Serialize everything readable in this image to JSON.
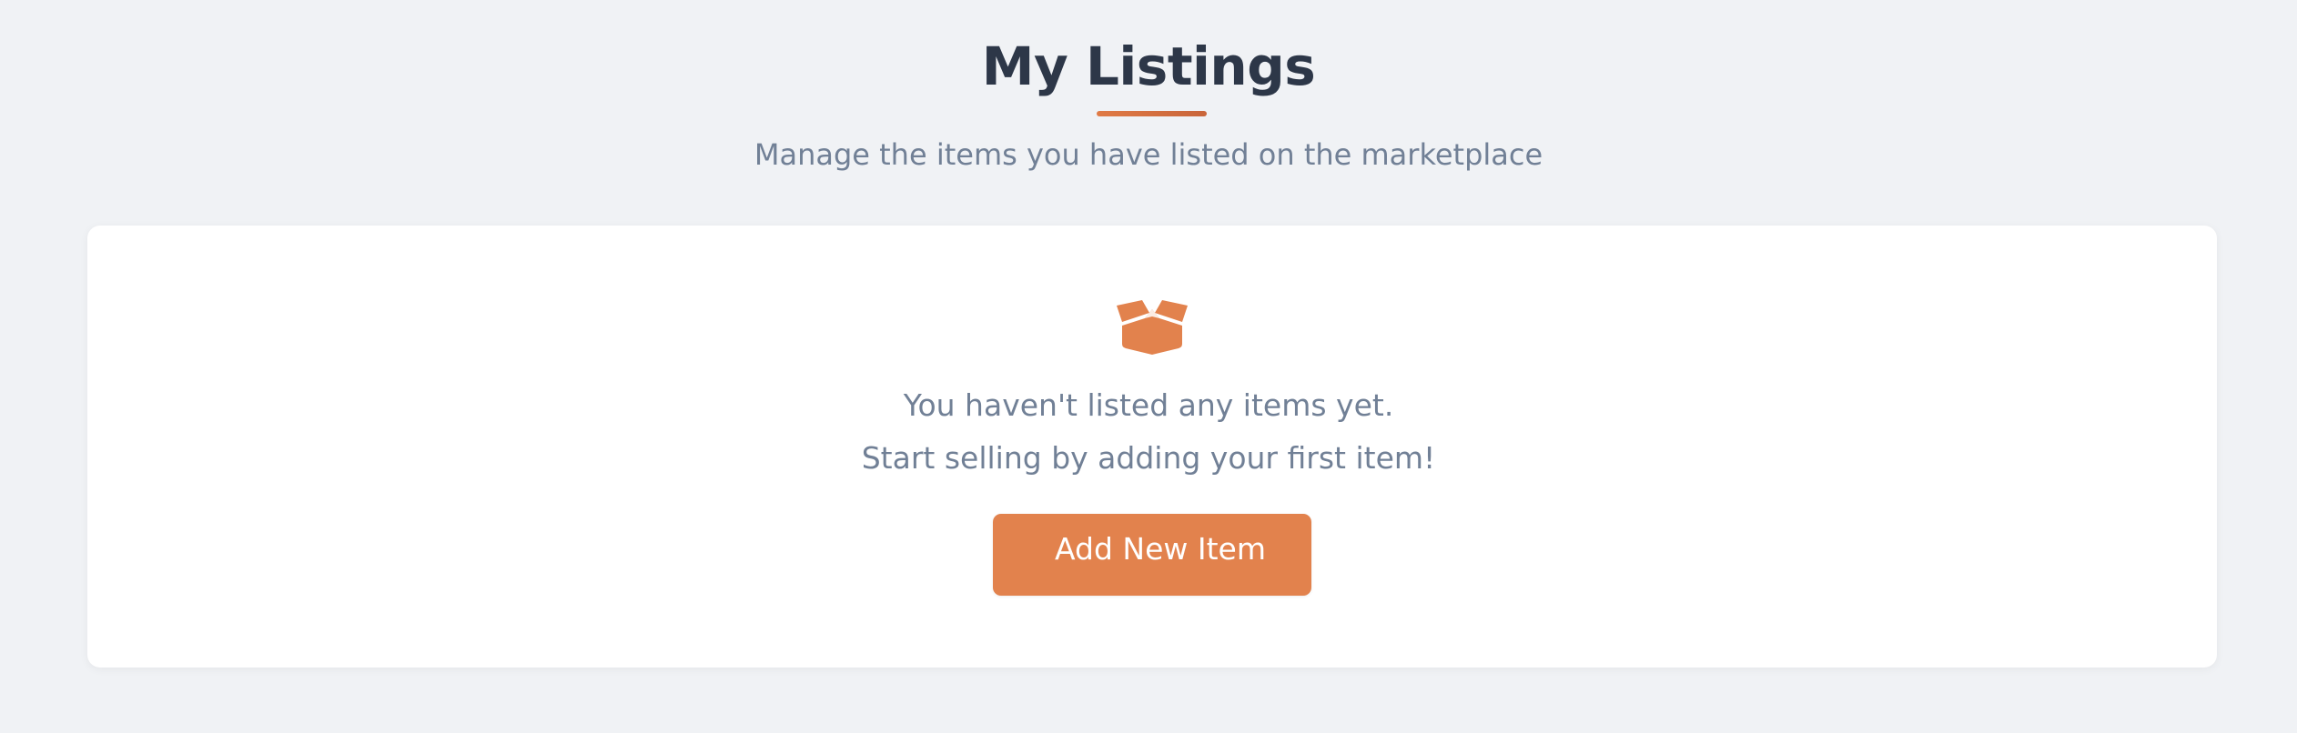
{
  "header": {
    "title": "My Listings",
    "subtitle": "Manage the items you have listed on the marketplace"
  },
  "empty_state": {
    "icon": "open-box-icon",
    "message_line1": "You haven't listed any items yet.",
    "message_line2": "Start selling by adding your first item!",
    "button_label": "Add New Item"
  },
  "colors": {
    "accent": "#e2824d",
    "title": "#2d3748",
    "muted_text": "#718096",
    "background": "#f0f2f5"
  }
}
